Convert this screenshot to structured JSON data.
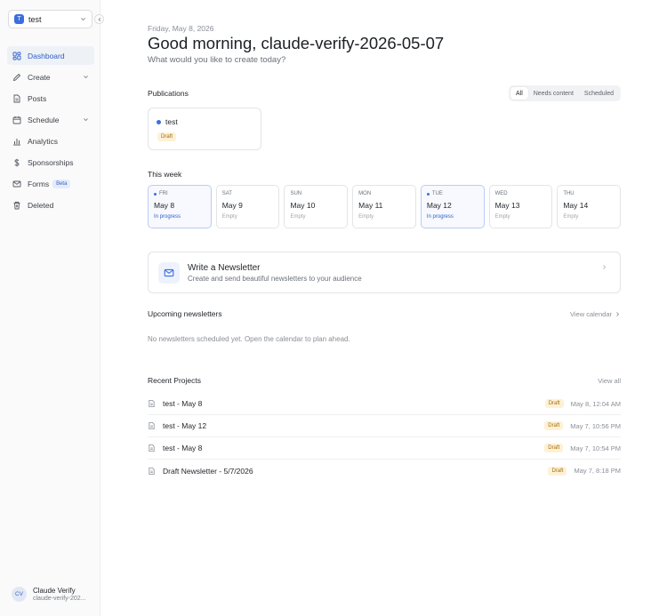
{
  "workspace": {
    "badge": "T",
    "name": "test"
  },
  "sidebar": {
    "items": [
      {
        "label": "Dashboard"
      },
      {
        "label": "Create"
      },
      {
        "label": "Posts"
      },
      {
        "label": "Schedule"
      },
      {
        "label": "Analytics"
      },
      {
        "label": "Sponsorships"
      },
      {
        "label": "Forms",
        "badge": "Beta"
      },
      {
        "label": "Deleted"
      }
    ]
  },
  "user": {
    "initials": "CV",
    "name": "Claude Verify",
    "email": "claude-verify-202..."
  },
  "header": {
    "date": "Friday, May 8, 2026",
    "greeting": "Good morning, claude-verify-2026-05-07",
    "subtitle": "What would you like to create today?"
  },
  "publications": {
    "title": "Publications",
    "filters": [
      "All",
      "Needs content",
      "Scheduled"
    ],
    "active_filter": "All",
    "cards": [
      {
        "name": "test",
        "status": "Draft"
      }
    ]
  },
  "week": {
    "title": "This week",
    "days": [
      {
        "name": "FRI",
        "date": "May 8",
        "status": "In progress"
      },
      {
        "name": "SAT",
        "date": "May 9",
        "status": "Empty"
      },
      {
        "name": "SUN",
        "date": "May 10",
        "status": "Empty"
      },
      {
        "name": "MON",
        "date": "May 11",
        "status": "Empty"
      },
      {
        "name": "TUE",
        "date": "May 12",
        "status": "In progress"
      },
      {
        "name": "WED",
        "date": "May 13",
        "status": "Empty"
      },
      {
        "name": "THU",
        "date": "May 14",
        "status": "Empty"
      }
    ]
  },
  "write": {
    "title": "Write a Newsletter",
    "subtitle": "Create and send beautiful newsletters to your audience"
  },
  "upcoming": {
    "title": "Upcoming newsletters",
    "link": "View calendar",
    "empty": "No newsletters scheduled yet. Open the calendar to plan ahead."
  },
  "projects": {
    "title": "Recent Projects",
    "link": "View all",
    "rows": [
      {
        "name": "test - May 8",
        "status": "Draft",
        "time": "May 8, 12:04 AM"
      },
      {
        "name": "test - May 12",
        "status": "Draft",
        "time": "May 7, 10:56 PM"
      },
      {
        "name": "test - May 8",
        "status": "Draft",
        "time": "May 7, 10:54 PM"
      },
      {
        "name": "Draft Newsletter - 5/7/2026",
        "status": "Draft",
        "time": "May 7, 8:18 PM"
      }
    ]
  },
  "colors": {
    "accent": "#3a6fe0",
    "draft_bg": "#fdf1d6",
    "draft_text": "#a66d0d"
  }
}
